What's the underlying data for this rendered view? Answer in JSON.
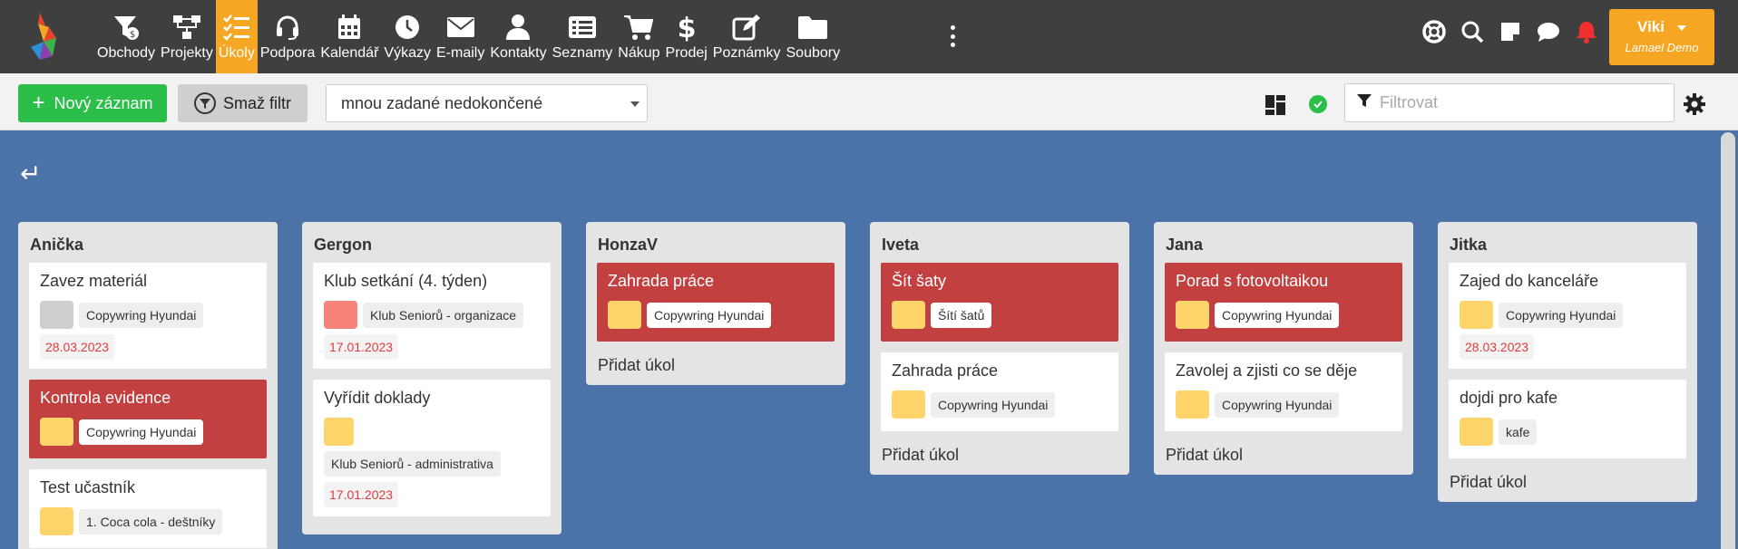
{
  "nav": {
    "items": [
      {
        "label": "Obchody",
        "icon": "funnel-dollar-icon"
      },
      {
        "label": "Projekty",
        "icon": "sitemap-icon"
      },
      {
        "label": "Úkoly",
        "icon": "tasks-icon",
        "active": true
      },
      {
        "label": "Podpora",
        "icon": "headset-icon"
      },
      {
        "label": "Kalendář",
        "icon": "calendar-icon"
      },
      {
        "label": "Výkazy",
        "icon": "clock-icon"
      },
      {
        "label": "E-maily",
        "icon": "envelope-icon"
      },
      {
        "label": "Kontakty",
        "icon": "user-icon"
      },
      {
        "label": "Seznamy",
        "icon": "list-icon"
      },
      {
        "label": "Nákup",
        "icon": "cart-icon"
      },
      {
        "label": "Prodej",
        "icon": "dollar-icon"
      },
      {
        "label": "Poznámky",
        "icon": "edit-icon"
      },
      {
        "label": "Soubory",
        "icon": "folder-icon"
      }
    ]
  },
  "user": {
    "name": "Viki",
    "company": "Lamael Demo"
  },
  "toolbar": {
    "new_label": "Nový záznam",
    "clear_filter_label": "Smaž filtr",
    "select_value": "mnou zadané nedokončené",
    "filter_placeholder": "Filtrovat"
  },
  "colors": {
    "nav_bg": "#3f3f3f",
    "accent": "#f5a623",
    "board_bg": "#4b73a8",
    "card_red": "#c24040",
    "green": "#2bbf4a"
  },
  "board": {
    "add_task_label": "Přidat úkol",
    "columns": [
      {
        "title": "Anička",
        "cards": [
          {
            "title": "Zavez materiál",
            "tag": "Copywring Hyundai",
            "date": "28.03.2023"
          },
          {
            "title": "Kontrola evidence",
            "tag": "Copywring Hyundai"
          },
          {
            "title": "Test učastník",
            "tag": "1. Coca cola - deštníky"
          }
        ]
      },
      {
        "title": "Gergon",
        "cards": [
          {
            "title": "Klub setkání (4. týden)",
            "tag": "Klub Seniorů - organizace",
            "date": "17.01.2023"
          },
          {
            "title": "Vyřídit doklady",
            "tag": "Klub Seniorů - administrativa",
            "date": "17.01.2023"
          }
        ]
      },
      {
        "title": "HonzaV",
        "cards": [
          {
            "title": "Zahrada práce",
            "tag": "Copywring Hyundai"
          }
        ]
      },
      {
        "title": "Iveta",
        "cards": [
          {
            "title": "Šít šaty",
            "tag": "Šítí šatů"
          },
          {
            "title": "Zahrada práce",
            "tag": "Copywring Hyundai"
          }
        ]
      },
      {
        "title": "Jana",
        "cards": [
          {
            "title": "Porad s fotovoltaikou",
            "tag": "Copywring Hyundai"
          },
          {
            "title": "Zavolej a zjisti co se děje",
            "tag": "Copywring Hyundai"
          }
        ]
      },
      {
        "title": "Jitka",
        "cards": [
          {
            "title": "Zajed do kanceláře",
            "tag": "Copywring Hyundai",
            "date": "28.03.2023"
          },
          {
            "title": "dojdi pro kafe",
            "tag": "kafe"
          }
        ]
      }
    ]
  }
}
